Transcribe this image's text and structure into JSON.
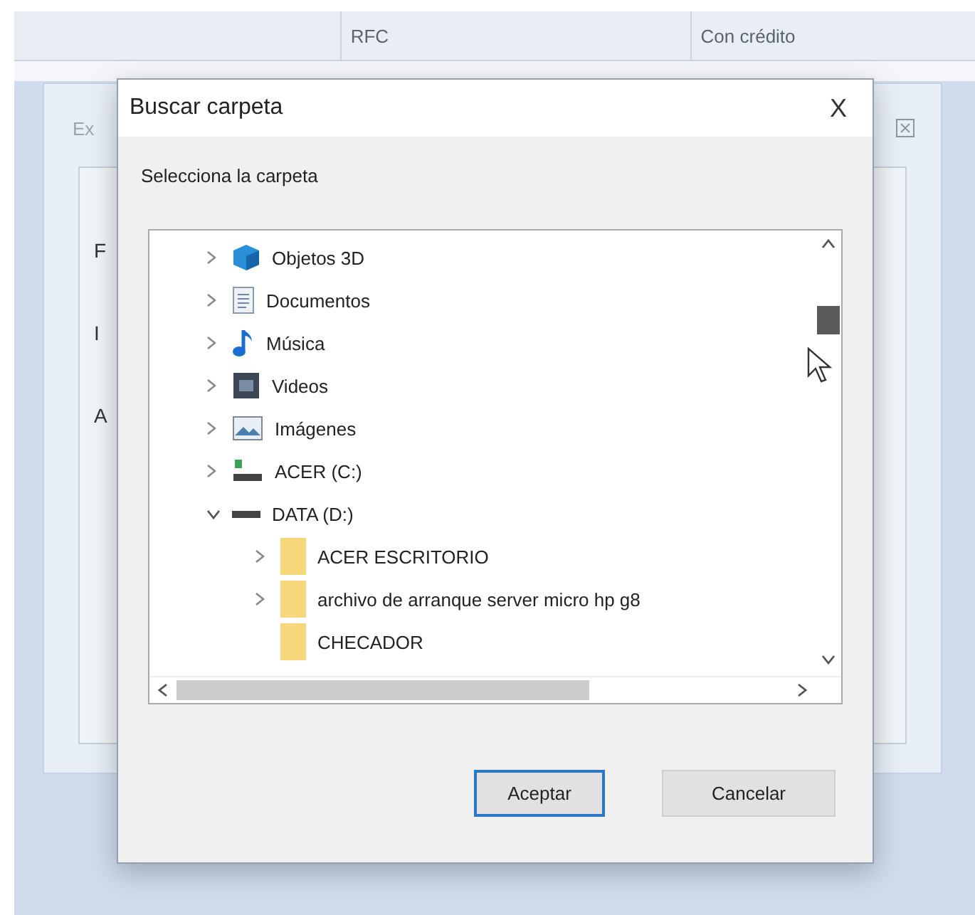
{
  "table_header": {
    "columns": [
      "RFC",
      "Con crédito"
    ]
  },
  "background_dialog": {
    "title": "Ex",
    "labels": [
      "F",
      "I",
      "A"
    ]
  },
  "dialog": {
    "title": "Buscar carpeta",
    "close": "X",
    "prompt": "Selecciona la carpeta",
    "tree": [
      {
        "label": "Objetos 3D",
        "kind": "objects3d",
        "expandable": true,
        "expanded": false
      },
      {
        "label": "Documentos",
        "kind": "documents",
        "expandable": true,
        "expanded": false
      },
      {
        "label": "Música",
        "kind": "music",
        "expandable": true,
        "expanded": false
      },
      {
        "label": "Videos",
        "kind": "videos",
        "expandable": true,
        "expanded": false
      },
      {
        "label": "Imágenes",
        "kind": "pictures",
        "expandable": true,
        "expanded": false
      },
      {
        "label": "ACER (C:)",
        "kind": "systemdrive",
        "expandable": true,
        "expanded": false
      },
      {
        "label": "DATA (D:)",
        "kind": "drive",
        "expandable": true,
        "expanded": true,
        "children": [
          {
            "label": "ACER ESCRITORIO",
            "kind": "folder",
            "expandable": true
          },
          {
            "label": "archivo de arranque server micro hp g8",
            "kind": "folder",
            "expandable": true
          },
          {
            "label": "CHECADOR",
            "kind": "folder",
            "expandable": false
          }
        ]
      }
    ],
    "buttons": [
      {
        "label": "Aceptar",
        "default": true
      },
      {
        "label": "Cancelar",
        "default": false
      }
    ]
  }
}
